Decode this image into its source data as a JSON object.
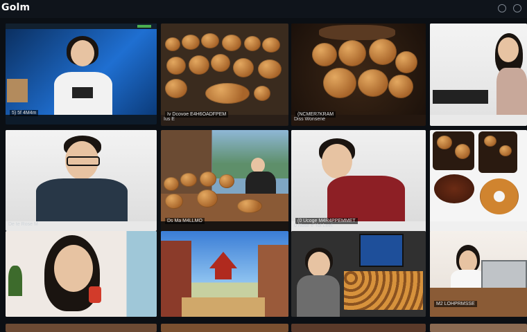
{
  "app": {
    "title": "Golm"
  },
  "tiles": [
    {
      "caption": "",
      "overlay": "5) 5f 4M4m"
    },
    {
      "caption": "Ius Е",
      "overlay": "Iv Dcovoe E4H6OADFPEM"
    },
    {
      "caption": "Diss Wonsene",
      "overlay": "(NCMER7KRAM"
    },
    {
      "caption": "",
      "overlay": ""
    },
    {
      "caption": "De te Rose M",
      "overlay": ""
    },
    {
      "caption": "",
      "overlay": "Ds Ma M4LLMO"
    },
    {
      "caption": "0 Nose e Yot Leet",
      "overlay": "(0 Ucoge M4R4PPEMMET"
    },
    {
      "caption": "",
      "overlay": ""
    },
    {
      "caption": "",
      "overlay": ""
    },
    {
      "caption": "",
      "overlay": ""
    },
    {
      "caption": "",
      "overlay": ""
    },
    {
      "caption": "",
      "overlay": "M2 LOHPRMSSE"
    }
  ],
  "colors": {
    "background": "#0b0f14",
    "topbar": "#0f141b",
    "accent": "#4caf50"
  }
}
